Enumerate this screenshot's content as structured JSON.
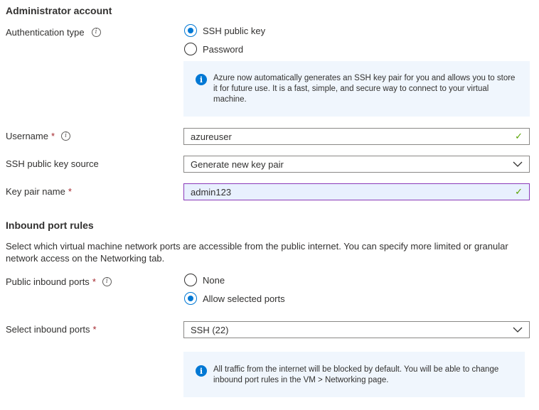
{
  "admin": {
    "title": "Administrator account",
    "auth_type_label": "Authentication type",
    "auth_options": [
      {
        "label": "SSH public key",
        "checked": true
      },
      {
        "label": "Password",
        "checked": false
      }
    ],
    "auth_info": "Azure now automatically generates an SSH key pair for you and allows you to store it for future use. It is a fast, simple, and secure way to connect to your virtual machine.",
    "username_label": "Username",
    "username_value": "azureuser",
    "ssh_source_label": "SSH public key source",
    "ssh_source_value": "Generate new key pair",
    "keypair_label": "Key pair name",
    "keypair_value": "admin123",
    "required_mark": "*",
    "info_glyph": "i",
    "check_glyph": "✓"
  },
  "inbound": {
    "title": "Inbound port rules",
    "description": "Select which virtual machine network ports are accessible from the public internet. You can specify more limited or granular network access on the Networking tab.",
    "public_ports_label": "Public inbound ports",
    "port_options": [
      {
        "label": "None",
        "checked": false
      },
      {
        "label": "Allow selected ports",
        "checked": true
      }
    ],
    "select_ports_label": "Select inbound ports",
    "select_ports_value": "SSH (22)",
    "ports_info": "All traffic from the internet will be blocked by default. You will be able to change inbound port rules in the VM > Networking page."
  },
  "colors": {
    "accent": "#0078d4",
    "required": "#a4262c",
    "valid_check": "#57a300",
    "info_bg": "#f0f6fd",
    "focus_border": "#8a3ab9"
  },
  "icons": [
    "info-circle-icon",
    "info-filled-icon",
    "checkmark-icon",
    "chevron-down-icon"
  ]
}
